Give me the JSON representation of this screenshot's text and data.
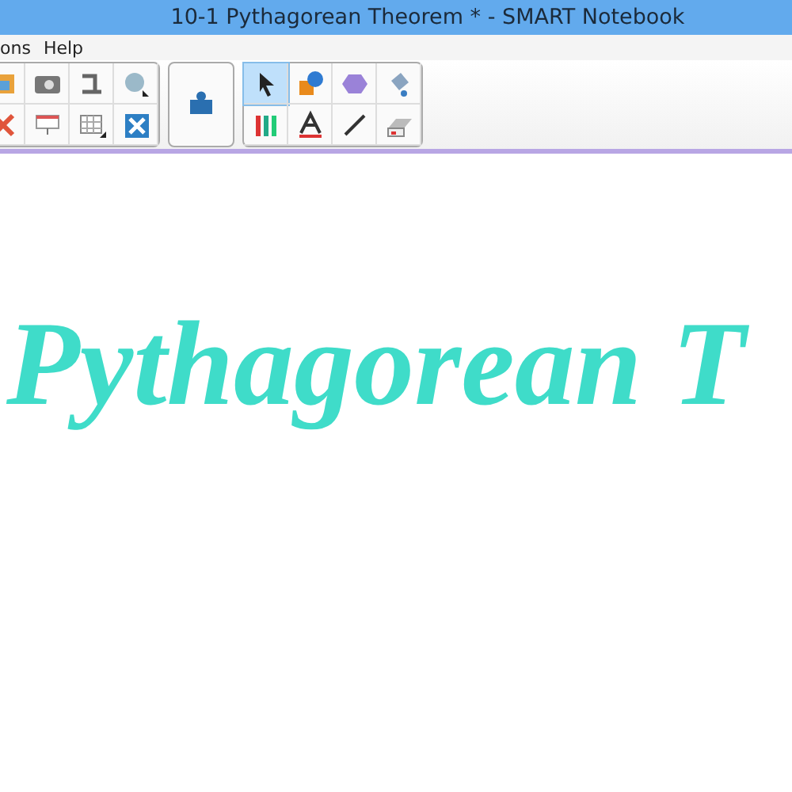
{
  "window": {
    "title": "10-1 Pythagorean Theorem * - SMART Notebook"
  },
  "menu": [
    "ons",
    "Help"
  ],
  "toolbar": {
    "pen_tools": [
      {
        "selected": true
      },
      {
        "selected": false
      },
      {
        "selected": false
      },
      {
        "selected": false
      },
      {
        "selected": false
      },
      {
        "selected": false
      },
      {
        "selected": false
      },
      {
        "selected": false
      }
    ]
  },
  "page": {
    "heading": "Pythagorean T"
  }
}
